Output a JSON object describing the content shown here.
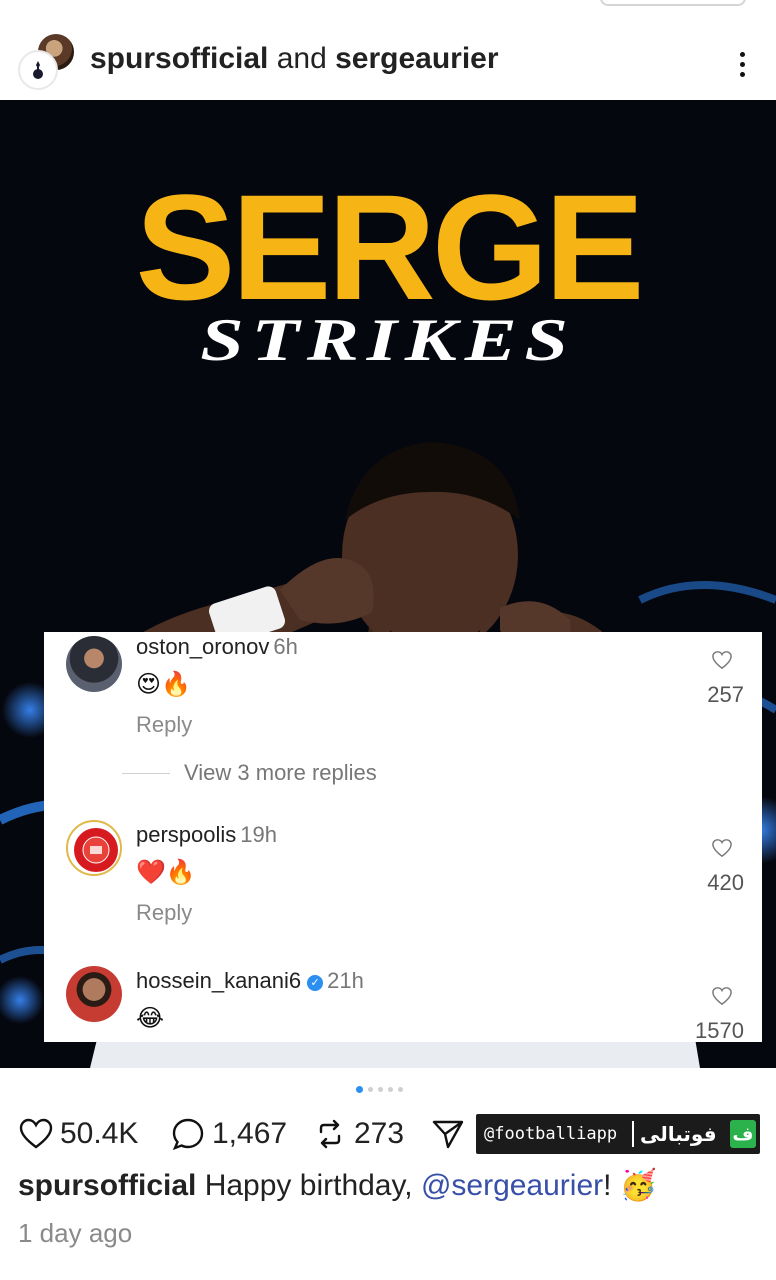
{
  "post": {
    "author": "spursofficial",
    "connector": " and ",
    "coauthor": "sergeaurier",
    "more_icon": "more-vertical-icon"
  },
  "media": {
    "headline": "SERGE",
    "subline": "STRIKES",
    "colors": {
      "headline": "#f7b515",
      "background": "#05070e"
    }
  },
  "comments": [
    {
      "username": "oston_oronov",
      "time": "6h",
      "text": "😍🔥",
      "reply_label": "Reply",
      "likes": "257"
    },
    {
      "username": "perspoolis",
      "time": "19h",
      "text": "❤️🔥",
      "reply_label": "Reply",
      "likes": "420"
    },
    {
      "username": "hossein_kanani6",
      "time": "21h",
      "text": "😂",
      "likes": "1570",
      "verified": true
    }
  ],
  "view_more_replies": "View 3 more replies",
  "carousel": {
    "count": 5,
    "active_index": 0
  },
  "actions": {
    "likes": "50.4K",
    "comments": "1,467",
    "reposts": "273"
  },
  "watermark": {
    "handle": "@footballiapp",
    "brand": "فوتبالی",
    "logo": "ف"
  },
  "caption": {
    "author": "spursofficial",
    "text": " Happy birthday, ",
    "mention": "@sergeaurier",
    "end": "! 🥳"
  },
  "time_ago": "1 day ago"
}
